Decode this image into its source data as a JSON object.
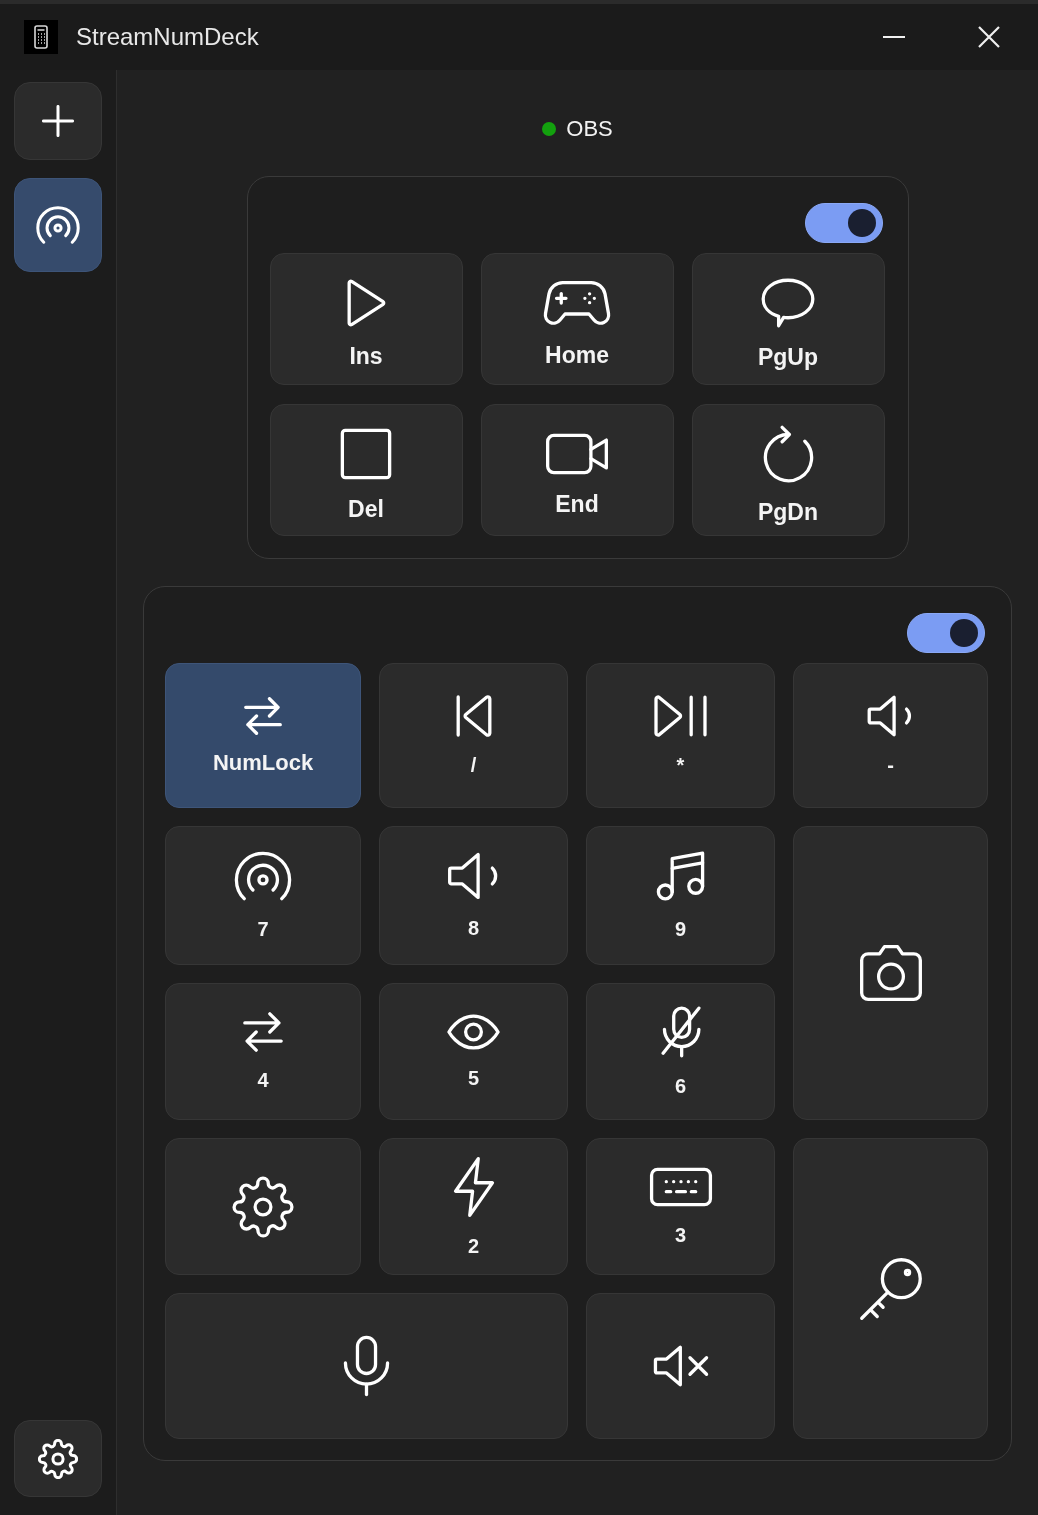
{
  "window": {
    "title": "StreamNumDeck"
  },
  "sidebar": {
    "pages": [
      {
        "selected": true
      }
    ]
  },
  "status": {
    "label": "OBS",
    "connected": true
  },
  "groups": [
    {
      "kind": "navigation",
      "on": true,
      "keys": [
        {
          "label": "Ins"
        },
        {
          "label": "Home"
        },
        {
          "label": "PgUp"
        },
        {
          "label": "Del"
        },
        {
          "label": "End"
        },
        {
          "label": "PgDn"
        }
      ]
    },
    {
      "kind": "numpad",
      "on": true,
      "keys": [
        {
          "kind": "normal",
          "label": "NumLock",
          "selected": true
        },
        {
          "kind": "normal",
          "label": "/",
          "selected": false
        },
        {
          "kind": "normal",
          "label": "*",
          "selected": false
        },
        {
          "kind": "normal",
          "label": "-",
          "selected": false
        },
        {
          "kind": "normal",
          "label": "7",
          "selected": false
        },
        {
          "kind": "normal",
          "label": "8",
          "selected": false
        },
        {
          "kind": "normal",
          "label": "9",
          "selected": false
        },
        {
          "kind": "tall",
          "selected": false
        },
        {
          "kind": "normal",
          "label": "4",
          "selected": false
        },
        {
          "kind": "normal",
          "label": "5",
          "selected": false
        },
        {
          "kind": "normal",
          "label": "6",
          "selected": false
        },
        {
          "kind": "normal",
          "selected": false
        },
        {
          "kind": "normal",
          "label": "2",
          "selected": false
        },
        {
          "kind": "normal",
          "label": "3",
          "selected": false
        },
        {
          "kind": "tall",
          "selected": false
        },
        {
          "kind": "wide",
          "selected": false
        },
        {
          "kind": "normal",
          "selected": false
        }
      ]
    }
  ]
}
